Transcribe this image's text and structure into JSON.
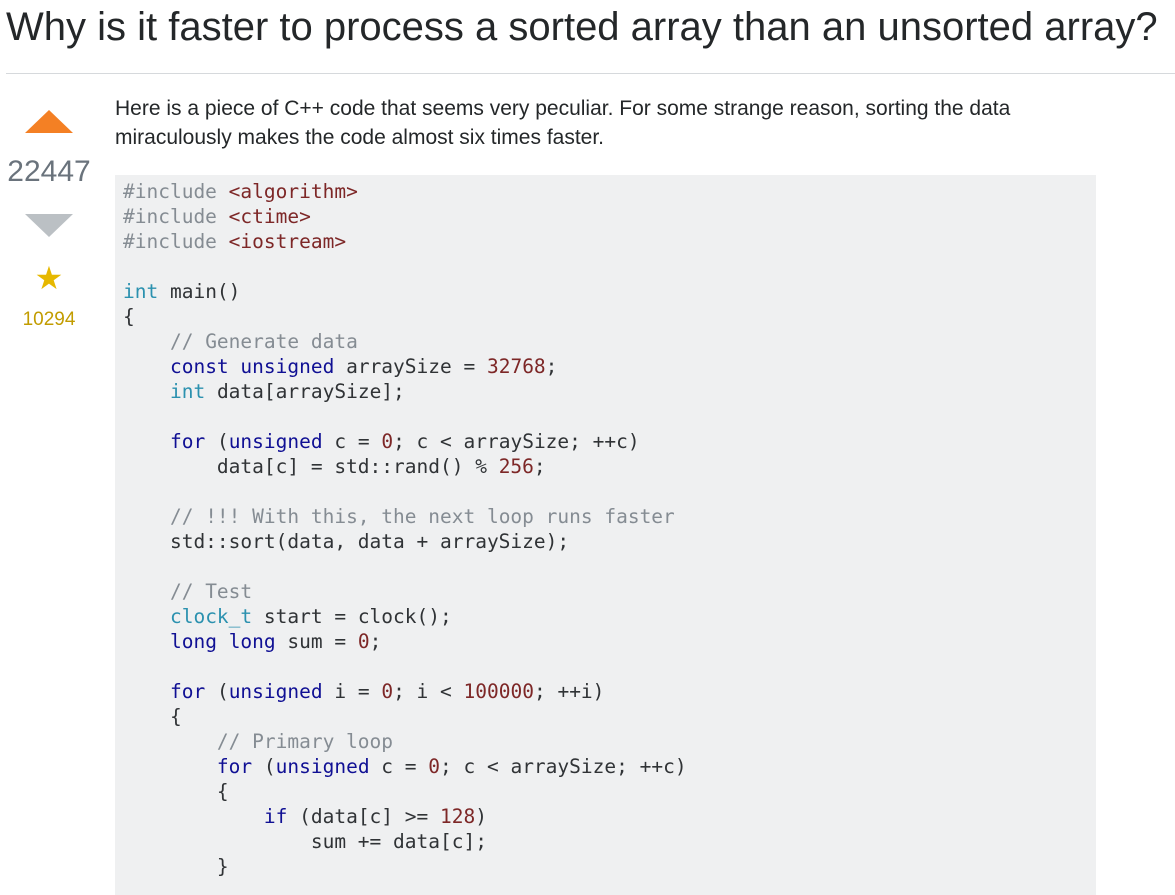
{
  "question": {
    "title": "Why is it faster to process a sorted array than an unsorted array?",
    "intro": "Here is a piece of C++ code that seems very peculiar. For some strange reason, sorting the data miraculously makes the code almost six times faster."
  },
  "votes": {
    "score": "22447",
    "favorites": "10294",
    "colors": {
      "upvote_active": "#f48024",
      "downvote": "#bbc0c4",
      "favorite_star": "#e6b800",
      "favorite_count": "#c29c00"
    }
  },
  "code": {
    "language": "C++",
    "lines": [
      [
        [
          "com",
          "#include "
        ],
        [
          "str",
          "<algorithm>"
        ]
      ],
      [
        [
          "com",
          "#include "
        ],
        [
          "str",
          "<ctime>"
        ]
      ],
      [
        [
          "com",
          "#include "
        ],
        [
          "str",
          "<iostream>"
        ]
      ],
      [],
      [
        [
          "typ",
          "int"
        ],
        [
          "pln",
          " main()"
        ]
      ],
      [
        [
          "pln",
          "{"
        ]
      ],
      [
        [
          "pln",
          "    "
        ],
        [
          "com",
          "// Generate data"
        ]
      ],
      [
        [
          "pln",
          "    "
        ],
        [
          "kw",
          "const"
        ],
        [
          "pln",
          " "
        ],
        [
          "kw",
          "unsigned"
        ],
        [
          "pln",
          " arraySize = "
        ],
        [
          "num",
          "32768"
        ],
        [
          "pln",
          ";"
        ]
      ],
      [
        [
          "pln",
          "    "
        ],
        [
          "typ",
          "int"
        ],
        [
          "pln",
          " data[arraySize];"
        ]
      ],
      [],
      [
        [
          "pln",
          "    "
        ],
        [
          "kw",
          "for"
        ],
        [
          "pln",
          " ("
        ],
        [
          "kw",
          "unsigned"
        ],
        [
          "pln",
          " c = "
        ],
        [
          "num",
          "0"
        ],
        [
          "pln",
          "; c < arraySize; ++c)"
        ]
      ],
      [
        [
          "pln",
          "        data[c] = std::rand() % "
        ],
        [
          "num",
          "256"
        ],
        [
          "pln",
          ";"
        ]
      ],
      [],
      [
        [
          "pln",
          "    "
        ],
        [
          "com",
          "// !!! With this, the next loop runs faster"
        ]
      ],
      [
        [
          "pln",
          "    std::sort(data, data + arraySize);"
        ]
      ],
      [],
      [
        [
          "pln",
          "    "
        ],
        [
          "com",
          "// Test"
        ]
      ],
      [
        [
          "pln",
          "    "
        ],
        [
          "typ",
          "clock_t"
        ],
        [
          "pln",
          " start = clock();"
        ]
      ],
      [
        [
          "pln",
          "    "
        ],
        [
          "kw",
          "long"
        ],
        [
          "pln",
          " "
        ],
        [
          "kw",
          "long"
        ],
        [
          "pln",
          " sum = "
        ],
        [
          "num",
          "0"
        ],
        [
          "pln",
          ";"
        ]
      ],
      [],
      [
        [
          "pln",
          "    "
        ],
        [
          "kw",
          "for"
        ],
        [
          "pln",
          " ("
        ],
        [
          "kw",
          "unsigned"
        ],
        [
          "pln",
          " i = "
        ],
        [
          "num",
          "0"
        ],
        [
          "pln",
          "; i < "
        ],
        [
          "num",
          "100000"
        ],
        [
          "pln",
          "; ++i)"
        ]
      ],
      [
        [
          "pln",
          "    {"
        ]
      ],
      [
        [
          "pln",
          "        "
        ],
        [
          "com",
          "// Primary loop"
        ]
      ],
      [
        [
          "pln",
          "        "
        ],
        [
          "kw",
          "for"
        ],
        [
          "pln",
          " ("
        ],
        [
          "kw",
          "unsigned"
        ],
        [
          "pln",
          " c = "
        ],
        [
          "num",
          "0"
        ],
        [
          "pln",
          "; c < arraySize; ++c)"
        ]
      ],
      [
        [
          "pln",
          "        {"
        ]
      ],
      [
        [
          "pln",
          "            "
        ],
        [
          "kw",
          "if"
        ],
        [
          "pln",
          " (data[c] >= "
        ],
        [
          "num",
          "128"
        ],
        [
          "pln",
          ")"
        ]
      ],
      [
        [
          "pln",
          "                sum += data[c];"
        ]
      ],
      [
        [
          "pln",
          "        }"
        ]
      ]
    ]
  }
}
